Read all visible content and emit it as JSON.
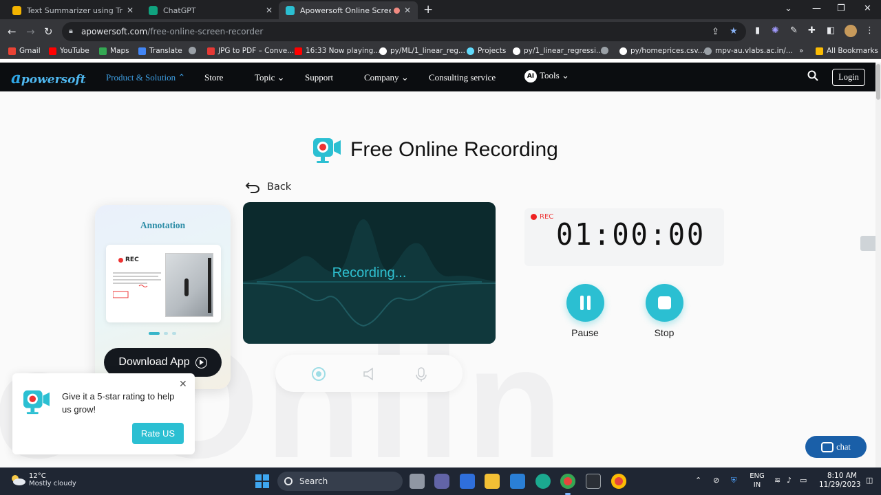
{
  "browser": {
    "tabs": [
      {
        "title": "Text Summarizer using Transform",
        "active": false
      },
      {
        "title": "ChatGPT",
        "active": false
      },
      {
        "title": "Apowersoft Online Screen R",
        "active": true
      }
    ],
    "url_domain": "apowersoft.com",
    "url_path": "/free-online-screen-recorder",
    "bookmarks": [
      {
        "label": "Gmail",
        "color": "#ea4335"
      },
      {
        "label": "YouTube",
        "color": "#ff0000"
      },
      {
        "label": "Maps",
        "color": "#34a853"
      },
      {
        "label": "Translate",
        "color": "#4285f4"
      },
      {
        "label": "",
        "color": "#9aa0a6"
      },
      {
        "label": "JPG to PDF – Conve...",
        "color": "#e53935"
      },
      {
        "label": "16:33 Now playing...",
        "color": "#ff0000"
      },
      {
        "label": "py/ML/1_linear_reg...",
        "color": "#ffffff"
      },
      {
        "label": "Projects",
        "color": "#61dafb"
      },
      {
        "label": "py/1_linear_regressi...",
        "color": "#ffffff"
      },
      {
        "label": "",
        "color": "#9aa0a6"
      },
      {
        "label": "py/homeprices.csv...",
        "color": "#ffffff"
      },
      {
        "label": "mpv-au.vlabs.ac.in/...",
        "color": "#9aa0a6"
      }
    ],
    "bookmarks_overflow": "»",
    "all_bookmarks": "All Bookmarks"
  },
  "site": {
    "logo": "apowersoft",
    "nav": [
      {
        "label": "Product & Solution",
        "chevron": "up",
        "highlight": true
      },
      {
        "label": "Store",
        "chevron": "",
        "highlight": false
      },
      {
        "label": "Topic",
        "chevron": "down",
        "highlight": false
      },
      {
        "label": "Support",
        "chevron": "",
        "highlight": false
      },
      {
        "label": "Company",
        "chevron": "down",
        "highlight": false
      },
      {
        "label": "Consulting service",
        "chevron": "",
        "highlight": false
      },
      {
        "label": "Tools",
        "chevron": "down",
        "highlight": false,
        "badge": "AI"
      }
    ],
    "login": "Login"
  },
  "main": {
    "title": "Free Online Recording",
    "back": "Back",
    "background_word": "e Onlin",
    "annotation": {
      "title": "Annotation",
      "rec": "REC",
      "download": "Download App"
    },
    "recording": {
      "status": "Recording..."
    },
    "timer": {
      "rec": "REC",
      "time": "01:00:00"
    },
    "controls": {
      "pause": "Pause",
      "stop": "Stop"
    },
    "rating": {
      "text": "Give it a 5-star rating to help us grow!",
      "button": "Rate US"
    },
    "chat": "chat"
  },
  "taskbar": {
    "weather_temp": "12°C",
    "weather_desc": "Mostly cloudy",
    "search": "Search",
    "lang1": "ENG",
    "lang2": "IN",
    "time": "8:10 AM",
    "date": "11/29/2023"
  },
  "colors": {
    "accent": "#2bbfd2",
    "nav_bg": "#0b0d10",
    "brand": "#2ea7e8",
    "rec_red": "#e33333"
  }
}
